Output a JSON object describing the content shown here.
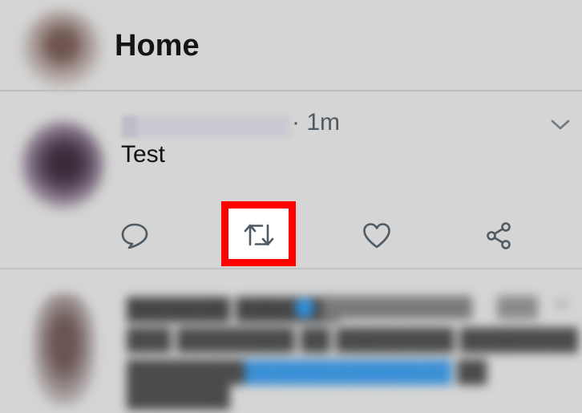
{
  "header": {
    "title": "Home"
  },
  "tweet": {
    "time": "· 1m",
    "text": "Test",
    "actions": [
      {
        "name": "reply",
        "icon": "reply-icon"
      },
      {
        "name": "retweet",
        "icon": "retweet-icon",
        "highlighted": true
      },
      {
        "name": "like",
        "icon": "heart-icon"
      },
      {
        "name": "share",
        "icon": "share-icon"
      }
    ]
  },
  "colors": {
    "background": "#d5d5d5",
    "highlight": "#ff0000",
    "icon": "#4f5a63",
    "verified": "#2d93e0"
  }
}
